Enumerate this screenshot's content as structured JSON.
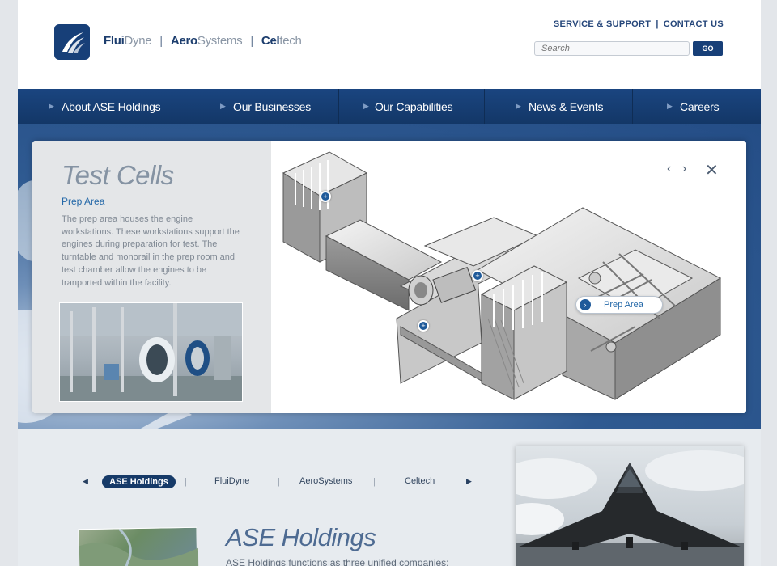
{
  "header": {
    "brands": [
      {
        "bold": "Flui",
        "light": "Dyne"
      },
      {
        "bold": "Aero",
        "light": "Systems"
      },
      {
        "bold": "Cel",
        "light": "tech"
      }
    ],
    "brand_separator": "|",
    "service_support": "SERVICE & SUPPORT",
    "util_separator": "|",
    "contact_us": "CONTACT US",
    "search_placeholder": "Search",
    "go_label": "GO"
  },
  "nav": {
    "items": [
      {
        "label": "About ASE Holdings"
      },
      {
        "label": "Our Businesses"
      },
      {
        "label": "Our Capabilities"
      },
      {
        "label": "News & Events"
      },
      {
        "label": "Careers"
      }
    ]
  },
  "hero": {
    "title": "Test Cells",
    "subtitle": "Prep Area",
    "body": "The prep area houses the engine workstations. These workstations support the engines during preparation for test. The turntable and monorail in the prep room and test chamber allow the engines to be tranported within the facility.",
    "callout_label": "Prep Area",
    "prev_icon": "‹",
    "next_icon": "›",
    "close_icon": "✕"
  },
  "company_tabs": {
    "items": [
      {
        "label": "ASE Holdings",
        "active": true
      },
      {
        "label": "FluiDyne"
      },
      {
        "label": "AeroSystems"
      },
      {
        "label": "Celtech"
      }
    ],
    "separator": "|"
  },
  "ase": {
    "title": "ASE Holdings",
    "body": "ASE Holdings functions as three unified companies:"
  },
  "colors": {
    "brand_navy": "#173f78",
    "link_blue": "#2468a8",
    "nav_bg": "#1a4580"
  }
}
